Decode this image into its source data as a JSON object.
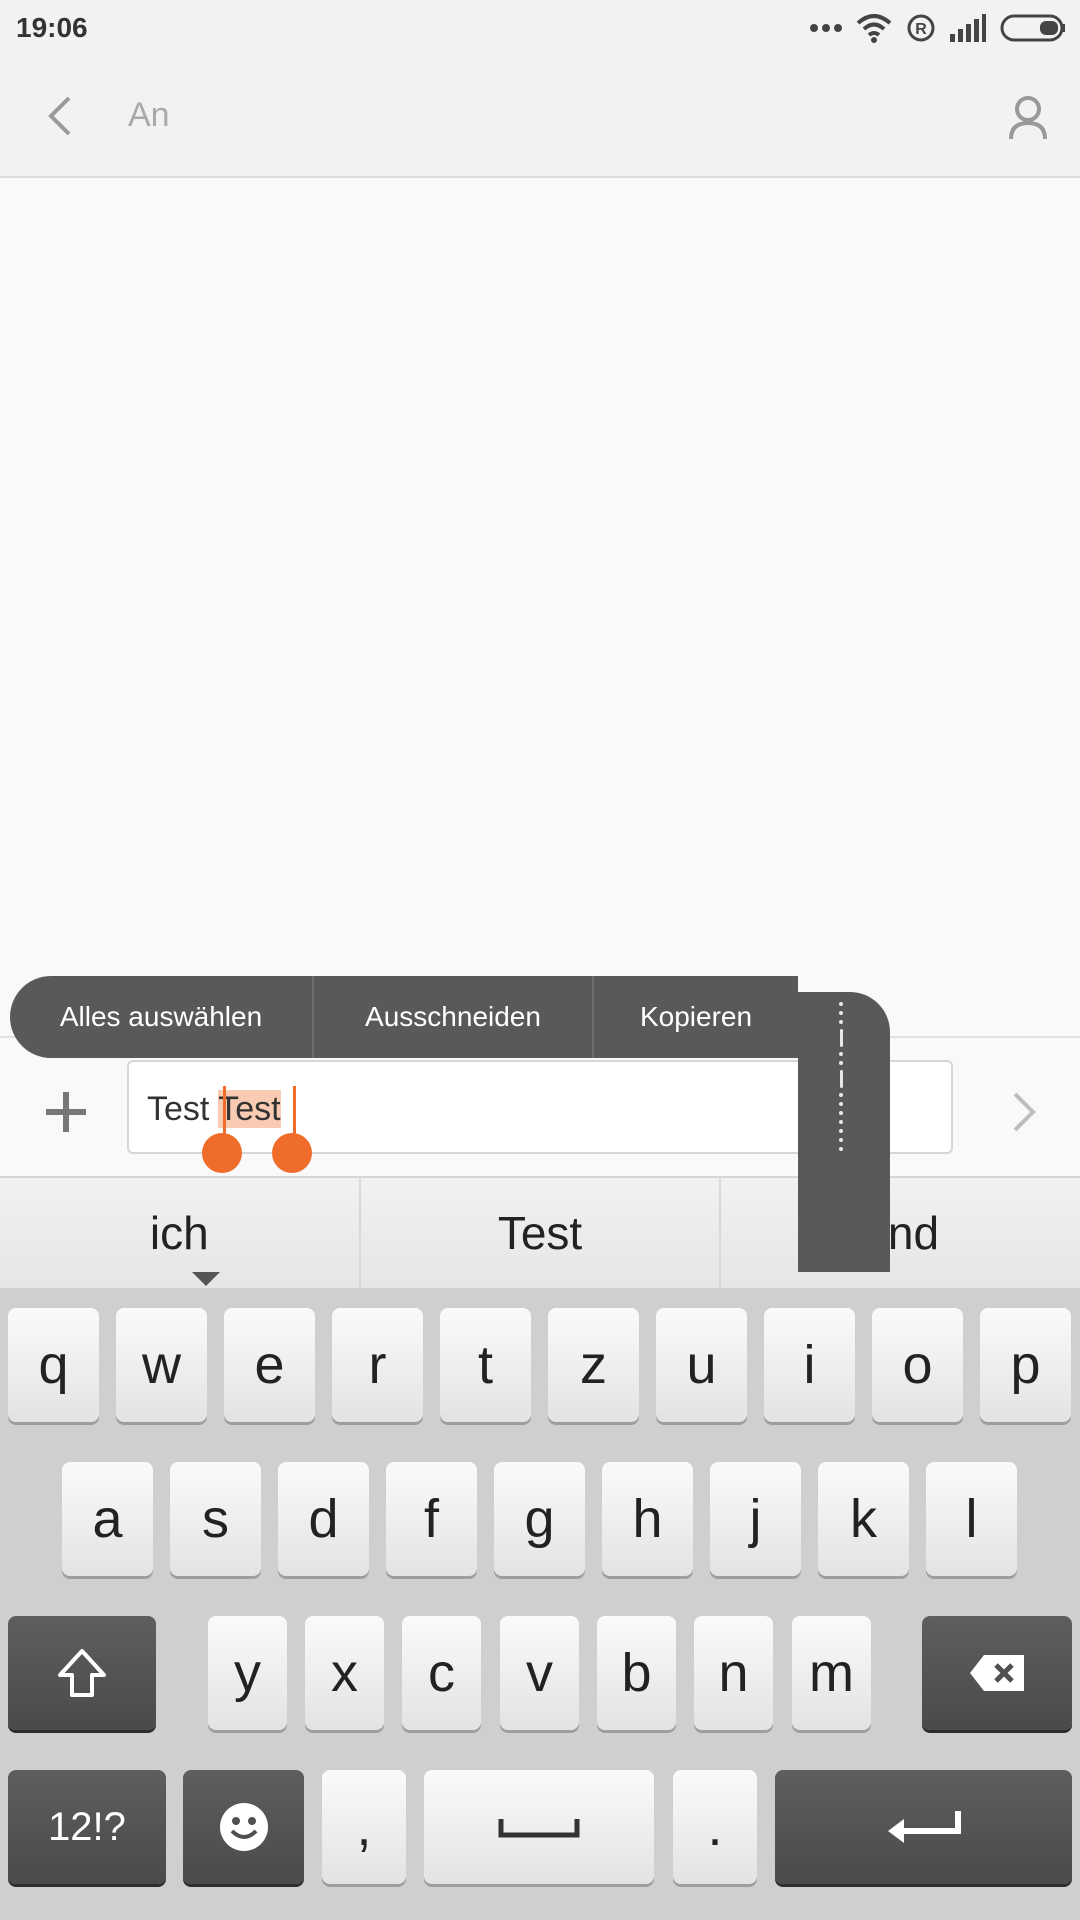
{
  "status_bar": {
    "time": "19:06"
  },
  "header": {
    "recipient_placeholder": "An",
    "back_icon": "chevron-left-icon",
    "contact_icon": "person-icon"
  },
  "compose": {
    "text_before": "Test ",
    "text_selected": "Test",
    "attach_icon": "plus-icon",
    "send_icon": "chevron-right-icon"
  },
  "context_menu": {
    "items": [
      "Alles auswählen",
      "Ausschneiden",
      "Kopieren"
    ],
    "more_icon": "more-vertical-icon"
  },
  "suggestions": [
    "ich",
    "Test",
    "und"
  ],
  "keyboard": {
    "row1": [
      "q",
      "w",
      "e",
      "r",
      "t",
      "z",
      "u",
      "i",
      "o",
      "p"
    ],
    "row2": [
      "a",
      "s",
      "d",
      "f",
      "g",
      "h",
      "j",
      "k",
      "l"
    ],
    "row3": [
      "y",
      "x",
      "c",
      "v",
      "b",
      "n",
      "m"
    ],
    "symbols_label": "12!?",
    "comma_label": ",",
    "period_label": ".",
    "shift_icon": "shift-icon",
    "backspace_icon": "backspace-icon",
    "emoji_icon": "smiley-icon",
    "space_icon": "space-bar-icon",
    "enter_icon": "enter-icon"
  },
  "colors": {
    "accent": "#ef6c2b",
    "selection": "#f8cbb2",
    "popup": "#595959"
  }
}
